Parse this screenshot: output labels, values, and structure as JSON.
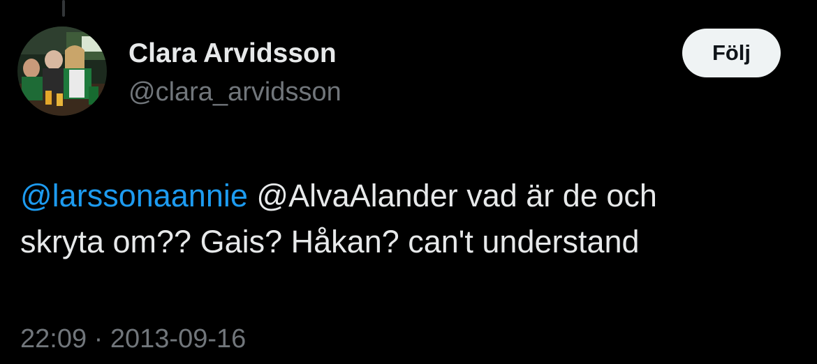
{
  "tweet": {
    "author": {
      "display_name": "Clara Arvidsson",
      "handle": "@clara_arvidsson",
      "avatar_icon": "profile-photo"
    },
    "follow_label": "Följ",
    "body": {
      "mention_1": "@larssonaannie",
      "text_line_1": " @AlvaAlander vad är de och",
      "text_line_2": "skryta om?? Gais? Håkan? can't understand"
    },
    "meta": {
      "time": "22:09",
      "separator": "·",
      "date": "2013-09-16"
    }
  },
  "colors": {
    "background": "#000000",
    "text_primary": "#e7e9ea",
    "text_secondary": "#71767b",
    "link": "#1d9bf0",
    "button_bg": "#eff3f4"
  }
}
